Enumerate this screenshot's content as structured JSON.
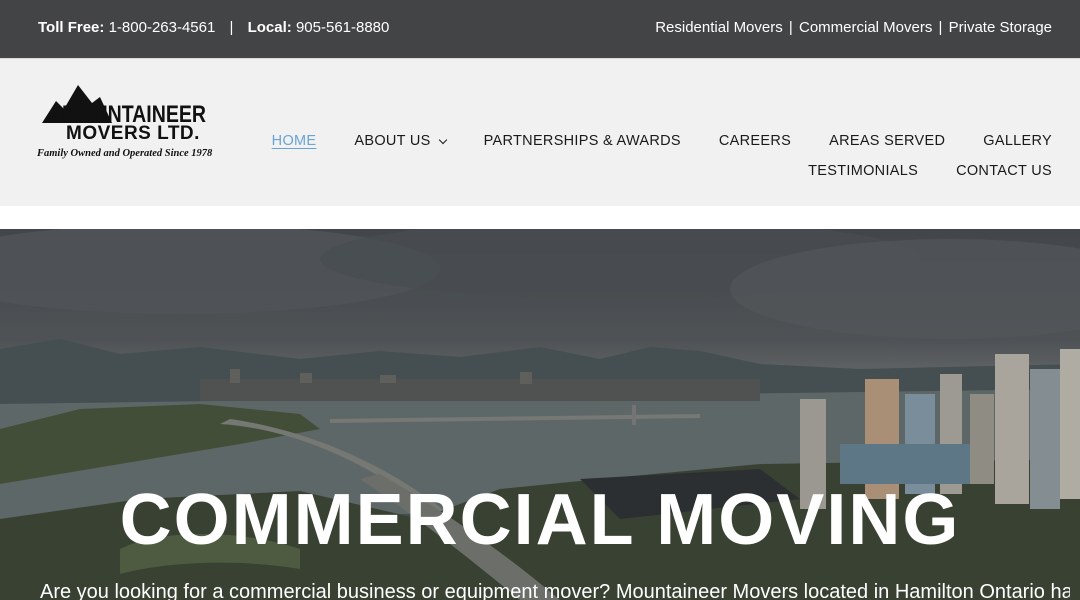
{
  "topbar": {
    "toll_free_label": "Toll Free:",
    "toll_free_number": "1-800-263-4561",
    "separator": "|",
    "local_label": "Local:",
    "local_number": "905-561-8880",
    "services": [
      "Residential Movers",
      "Commercial Movers",
      "Private Storage"
    ],
    "service_separator": "|"
  },
  "logo": {
    "wordmark_top": "MOUNTAINEER",
    "wordmark_bottom": "MOVERS LTD.",
    "tagline": "Family Owned and Operated Since 1978"
  },
  "nav": {
    "row1": [
      {
        "label": "HOME",
        "active": true
      },
      {
        "label": "ABOUT US",
        "dropdown": true
      },
      {
        "label": "PARTNERSHIPS & AWARDS"
      },
      {
        "label": "CAREERS"
      },
      {
        "label": "AREAS SERVED"
      },
      {
        "label": "GALLERY"
      }
    ],
    "row2": [
      {
        "label": "TESTIMONIALS"
      },
      {
        "label": "CONTACT US"
      }
    ],
    "active_color": "#6aa3d8"
  },
  "hero": {
    "title": "COMMERCIAL MOVING",
    "description": "Are you looking for a commercial business or equipment mover? Mountaineer Movers located in Hamilton Ontario has the"
  },
  "colors": {
    "topbar_bg": "#434446",
    "header_bg": "#f1f1f1"
  }
}
